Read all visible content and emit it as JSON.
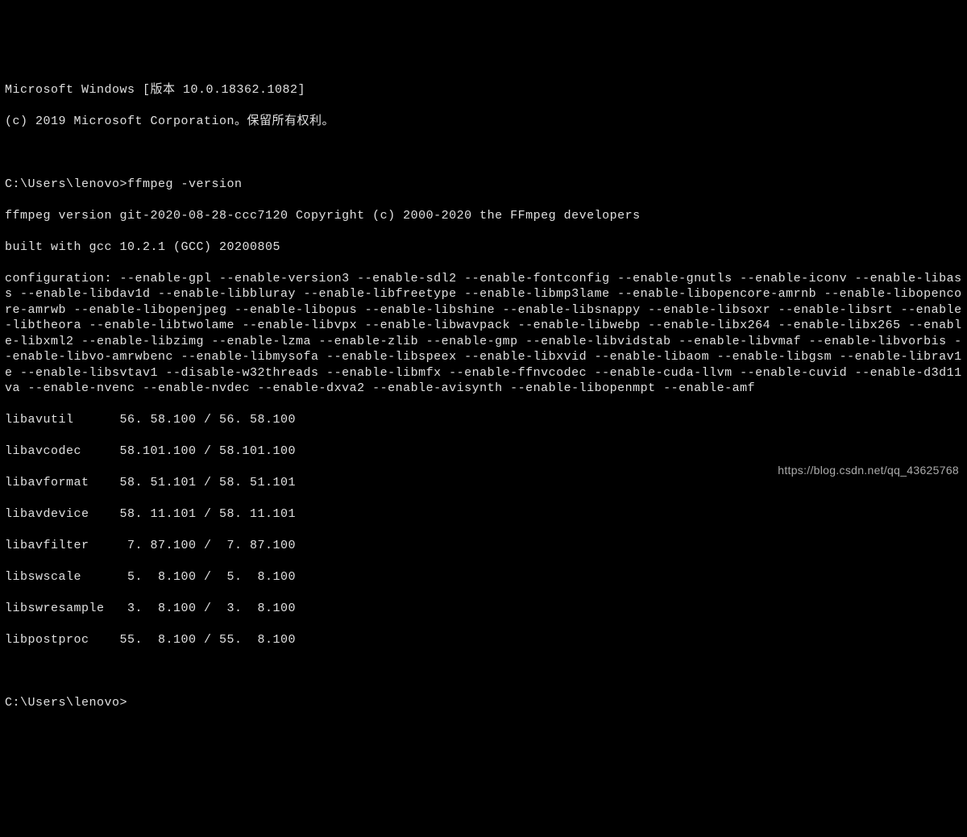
{
  "header": {
    "version_line": "Microsoft Windows [版本 10.0.18362.1082]",
    "copyright_line": "(c) 2019 Microsoft Corporation。保留所有权利。"
  },
  "session": {
    "prompt1": "C:\\Users\\lenovo>",
    "command1": "ffmpeg -version",
    "prompt2": "C:\\Users\\lenovo>"
  },
  "ffmpeg": {
    "version_line": "ffmpeg version git-2020-08-28-ccc7120 Copyright (c) 2000-2020 the FFmpeg developers",
    "built_line": "built with gcc 10.2.1 (GCC) 20200805",
    "configuration": "configuration: --enable-gpl --enable-version3 --enable-sdl2 --enable-fontconfig --enable-gnutls --enable-iconv --enable-libass --enable-libdav1d --enable-libbluray --enable-libfreetype --enable-libmp3lame --enable-libopencore-amrnb --enable-libopencore-amrwb --enable-libopenjpeg --enable-libopus --enable-libshine --enable-libsnappy --enable-libsoxr --enable-libsrt --enable-libtheora --enable-libtwolame --enable-libvpx --enable-libwavpack --enable-libwebp --enable-libx264 --enable-libx265 --enable-libxml2 --enable-libzimg --enable-lzma --enable-zlib --enable-gmp --enable-libvidstab --enable-libvmaf --enable-libvorbis --enable-libvo-amrwbenc --enable-libmysofa --enable-libspeex --enable-libxvid --enable-libaom --enable-libgsm --enable-librav1e --enable-libsvtav1 --disable-w32threads --enable-libmfx --enable-ffnvcodec --enable-cuda-llvm --enable-cuvid --enable-d3d11va --enable-nvenc --enable-nvdec --enable-dxva2 --enable-avisynth --enable-libopenmpt --enable-amf",
    "libs": [
      "libavutil      56. 58.100 / 56. 58.100",
      "libavcodec     58.101.100 / 58.101.100",
      "libavformat    58. 51.101 / 58. 51.101",
      "libavdevice    58. 11.101 / 58. 11.101",
      "libavfilter     7. 87.100 /  7. 87.100",
      "libswscale      5.  8.100 /  5.  8.100",
      "libswresample   3.  8.100 /  3.  8.100",
      "libpostproc    55.  8.100 / 55.  8.100"
    ]
  },
  "watermark": "https://blog.csdn.net/qq_43625768"
}
